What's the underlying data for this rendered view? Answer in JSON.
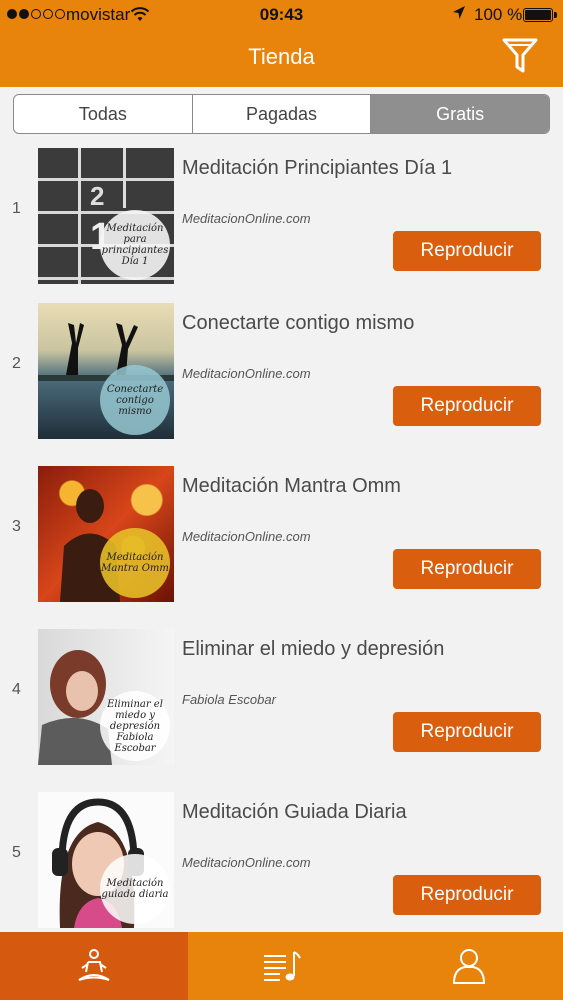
{
  "status": {
    "carrier": "movistar",
    "time": "09:43",
    "battery": "100 %",
    "signal_bars": 2
  },
  "header": {
    "title": "Tienda",
    "filter_icon": "filter-icon"
  },
  "segments": [
    "Todas",
    "Pagadas",
    "Gratis"
  ],
  "active_segment": "Gratis",
  "items": [
    {
      "num": "1",
      "title": "Meditación Principiantes Día 1",
      "author": "MeditacionOnline.com",
      "button": "Reproducir",
      "badge": "Meditación para principiantes Día 1"
    },
    {
      "num": "2",
      "title": "Conectarte contigo mismo",
      "author": "MeditacionOnline.com",
      "button": "Reproducir",
      "badge": "Conectarte contigo mismo"
    },
    {
      "num": "3",
      "title": "Meditación Mantra Omm",
      "author": "MeditacionOnline.com",
      "button": "Reproducir",
      "badge": "Meditación Mantra Omm"
    },
    {
      "num": "4",
      "title": "Eliminar el miedo y depresión",
      "author": "Fabiola Escobar",
      "button": "Reproducir",
      "badge": "Eliminar el miedo y depresión Fabiola Escobar"
    },
    {
      "num": "5",
      "title": "Meditación Guiada Diaria",
      "author": "MeditacionOnline.com",
      "button": "Reproducir",
      "badge": "Meditación guiada diaria"
    }
  ],
  "tabs": [
    {
      "icon": "meditation-icon",
      "active": true
    },
    {
      "icon": "playlist-icon",
      "active": false
    },
    {
      "icon": "profile-icon",
      "active": false
    }
  ],
  "colors": {
    "accent": "#e8830c",
    "button": "#d95f0e",
    "tab_active": "#d55a0f",
    "segment_active": "#8f8f8f"
  }
}
